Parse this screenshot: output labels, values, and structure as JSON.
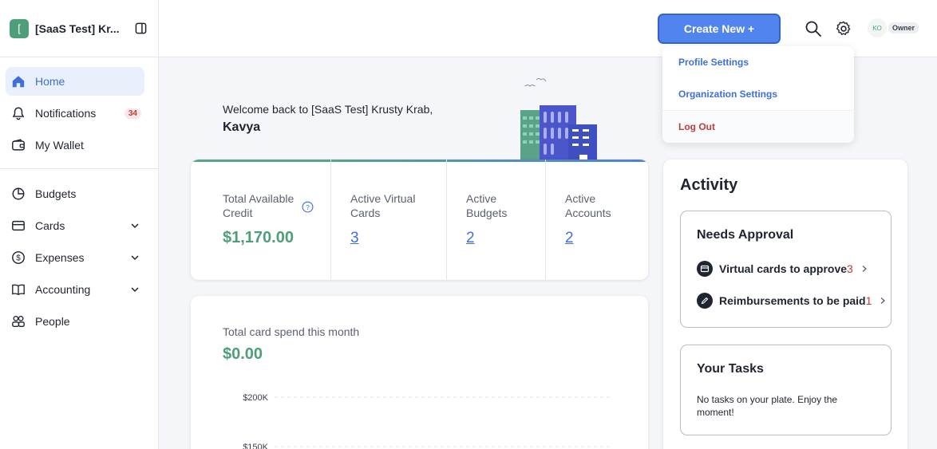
{
  "org": {
    "logo_letter": "[",
    "name": "[SaaS Test] Kr..."
  },
  "nav": {
    "items": [
      {
        "label": "Home",
        "icon": "home-icon"
      },
      {
        "label": "Notifications",
        "icon": "bell-icon",
        "badge": "34"
      },
      {
        "label": "My Wallet",
        "icon": "wallet-icon"
      }
    ],
    "items2": [
      {
        "label": "Budgets",
        "icon": "pie-icon"
      },
      {
        "label": "Cards",
        "icon": "card-icon"
      },
      {
        "label": "Expenses",
        "icon": "dollar-icon"
      },
      {
        "label": "Accounting",
        "icon": "book-icon"
      },
      {
        "label": "People",
        "icon": "people-icon"
      }
    ]
  },
  "topbar": {
    "create_label": "Create New +",
    "avatar_initials": "KO",
    "role": "Owner"
  },
  "dropdown": {
    "profile": "Profile Settings",
    "organization": "Organization Settings",
    "logout": "Log Out"
  },
  "welcome": {
    "line": "Welcome back to [SaaS Test] Krusty Krab,",
    "name": "Kavya"
  },
  "stats": {
    "credit_label": "Total Available Credit",
    "credit_value": "$1,170.00",
    "virtual_label": "Active Virtual Cards",
    "virtual_value": "3",
    "budgets_label": "Active Budgets",
    "budgets_value": "2",
    "accounts_label": "Active Accounts",
    "accounts_value": "2"
  },
  "spend": {
    "label": "Total card spend this month",
    "value": "$0.00",
    "ticks": [
      "$200K",
      "$150K"
    ]
  },
  "activity": {
    "title": "Activity",
    "approval_title": "Needs Approval",
    "virtual_cards_label": "Virtual cards to approve",
    "virtual_cards_count": "3",
    "reimb_label": "Reimbursements to be paid",
    "reimb_count": "1",
    "tasks_title": "Your Tasks",
    "tasks_text": "No tasks on your plate. Enjoy the moment!"
  }
}
